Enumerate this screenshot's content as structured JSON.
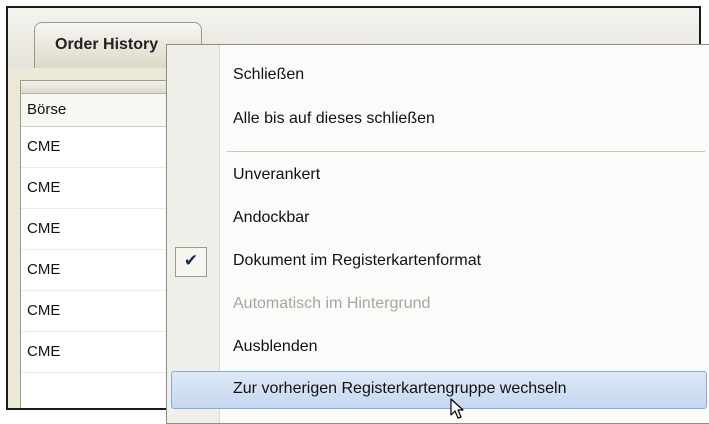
{
  "tab": {
    "title": "Order History"
  },
  "grid": {
    "column_header": "Börse",
    "rows": [
      "CME",
      "CME",
      "CME",
      "CME",
      "CME",
      "CME"
    ]
  },
  "context_menu": {
    "items": [
      {
        "label": "Schließen",
        "checked": false,
        "disabled": false
      },
      {
        "label": "Alle bis auf dieses schließen",
        "checked": false,
        "disabled": false
      },
      {
        "label": "Unverankert",
        "checked": false,
        "disabled": false
      },
      {
        "label": "Andockbar",
        "checked": false,
        "disabled": false
      },
      {
        "label": "Dokument im Registerkartenformat",
        "checked": true,
        "disabled": false
      },
      {
        "label": "Automatisch im Hintergrund",
        "checked": false,
        "disabled": true
      },
      {
        "label": "Ausblenden",
        "checked": false,
        "disabled": false
      },
      {
        "label": "Zur vorherigen Registerkartengruppe wechseln",
        "checked": false,
        "disabled": false,
        "hovered": true
      }
    ],
    "check_glyph": "✔"
  },
  "colors": {
    "hover_fill": "#c5d7f0",
    "hover_border": "#8aa9d6",
    "disabled_text": "#a6a6a0"
  }
}
